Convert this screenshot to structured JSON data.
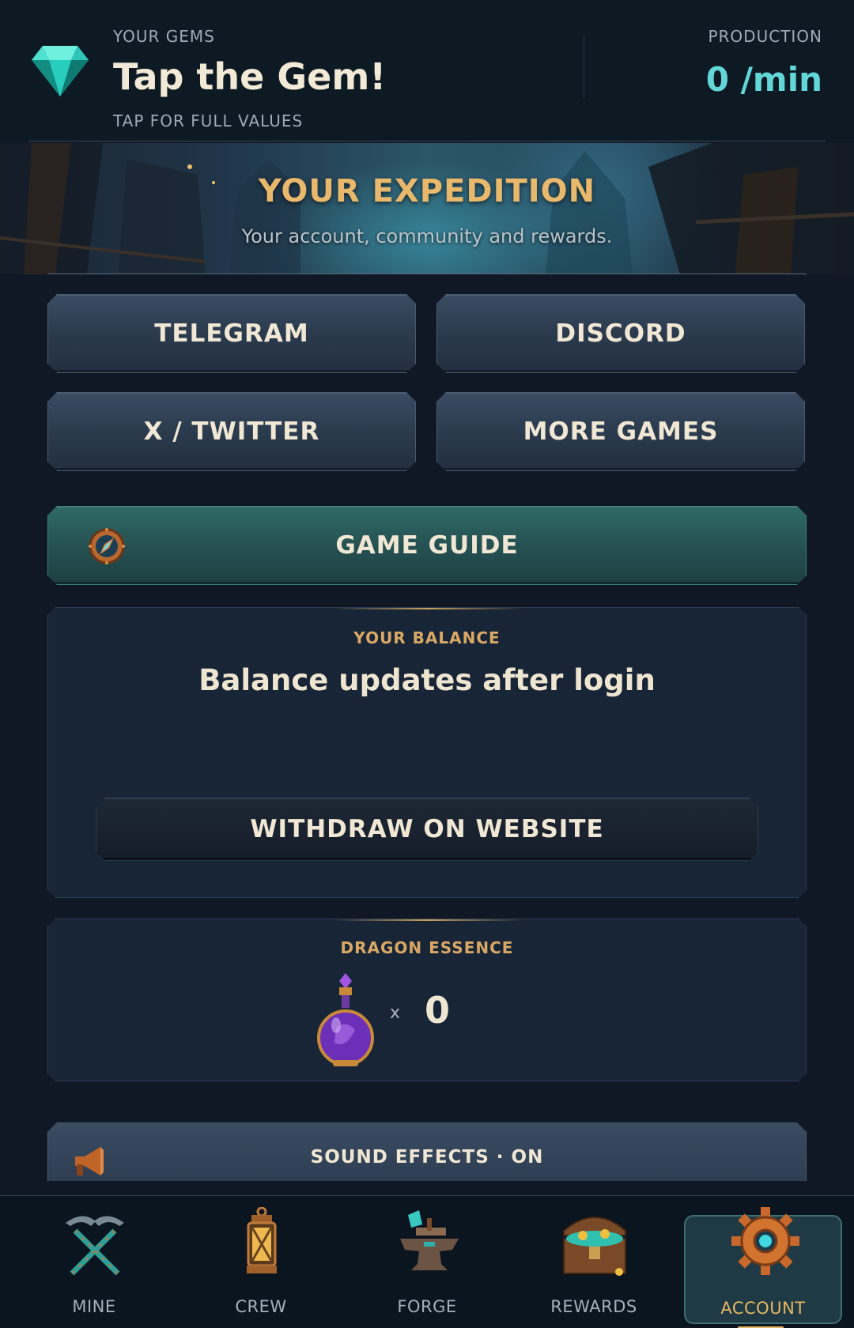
{
  "header": {
    "gems_label": "YOUR GEMS",
    "gems_value": "Tap the Gem!",
    "tap_hint": "TAP FOR FULL VALUES",
    "production_label": "PRODUCTION",
    "production_value": "0 /min",
    "icon": "gem-icon"
  },
  "banner": {
    "title": "YOUR EXPEDITION",
    "subtitle": "Your account, community and rewards."
  },
  "links": {
    "telegram": "TELEGRAM",
    "discord": "DISCORD",
    "twitter": "X / TWITTER",
    "more_games": "MORE GAMES"
  },
  "guide": {
    "label": "GAME GUIDE",
    "icon": "compass-icon"
  },
  "balance": {
    "label": "YOUR BALANCE",
    "value": "Balance updates after login",
    "withdraw_label": "WITHDRAW ON WEBSITE"
  },
  "essence": {
    "label": "DRAGON ESSENCE",
    "times": "x",
    "count": "0",
    "icon": "potion-icon"
  },
  "sound": {
    "label": "SOUND EFFECTS  ·  ON",
    "icon": "horn-icon"
  },
  "nav": {
    "items": [
      {
        "label": "MINE",
        "icon": "pickaxe-icon"
      },
      {
        "label": "CREW",
        "icon": "lantern-icon"
      },
      {
        "label": "FORGE",
        "icon": "anvil-icon"
      },
      {
        "label": "REWARDS",
        "icon": "chest-icon"
      },
      {
        "label": "ACCOUNT",
        "icon": "gear-icon",
        "active": true
      }
    ]
  },
  "colors": {
    "background": "#101826",
    "accent_gold": "#d9a865",
    "accent_teal": "#63d7d8",
    "guide_button": "#2f6a66"
  }
}
